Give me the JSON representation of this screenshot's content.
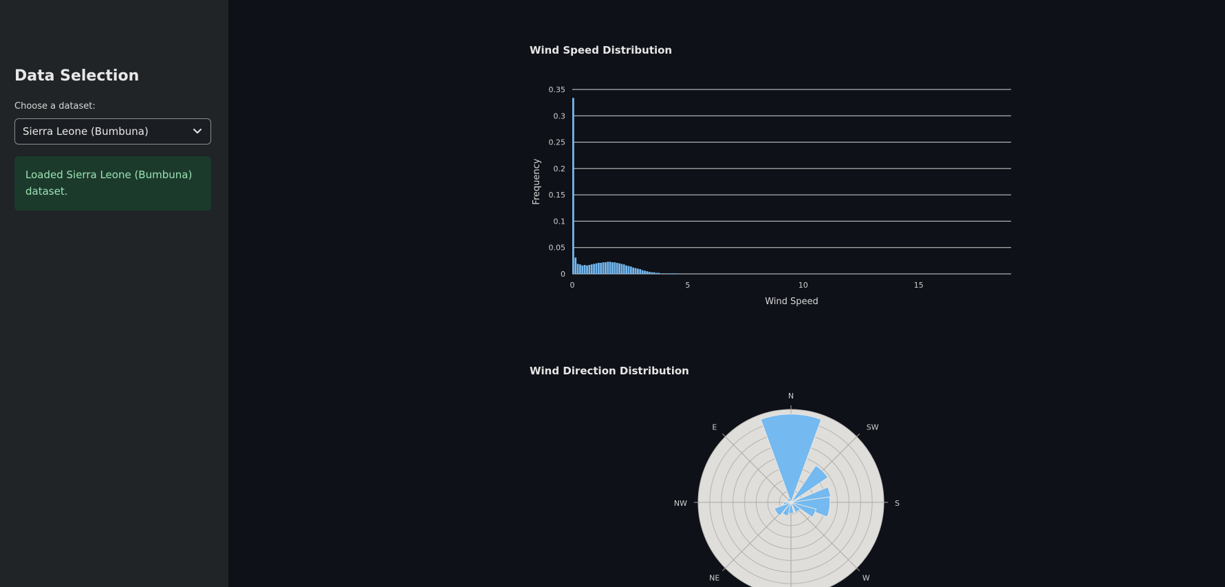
{
  "sidebar": {
    "title": "Data Selection",
    "select_label": "Choose a dataset:",
    "select_value": "Sierra Leone (Bumbuna)",
    "alert_text": "Loaded Sierra Leone (Bumbuna) dataset."
  },
  "colors": {
    "bar": "#74b9f0",
    "polar_bg": "#dfdedb",
    "alert_bg": "#1c3a2c",
    "alert_text": "#9be3b4"
  },
  "chart_data": [
    {
      "type": "bar",
      "title": "Wind Speed Distribution",
      "xlabel": "Wind Speed",
      "ylabel": "Frequency",
      "xlim": [
        0,
        19
      ],
      "ylim": [
        0,
        0.35
      ],
      "x_ticks": [
        "0",
        "5",
        "10",
        "15"
      ],
      "y_ticks": [
        "0",
        "0.05",
        "0.1",
        "0.15",
        "0.2",
        "0.25",
        "0.3",
        "0.35"
      ],
      "bin_width": 0.1,
      "values": [
        0.334,
        0.031,
        0.019,
        0.018,
        0.016,
        0.017,
        0.016,
        0.017,
        0.018,
        0.019,
        0.02,
        0.021,
        0.021,
        0.022,
        0.022,
        0.023,
        0.023,
        0.022,
        0.022,
        0.021,
        0.02,
        0.019,
        0.018,
        0.016,
        0.015,
        0.014,
        0.012,
        0.011,
        0.01,
        0.009,
        0.007,
        0.006,
        0.005,
        0.004,
        0.003,
        0.003,
        0.002,
        0.002,
        0.001,
        0.001,
        0.001,
        0.001,
        0.001,
        0.001,
        0.001,
        0.001
      ]
    },
    {
      "type": "barpolar",
      "title": "Wind Direction Distribution",
      "angular_labels": [
        "N",
        "SW",
        "S",
        "W",
        "NE",
        "NW",
        "E"
      ],
      "sectors": [
        {
          "center_deg": 0,
          "width_deg": 40,
          "r": 0.95
        },
        {
          "center_deg": 45,
          "width_deg": 22,
          "r": 0.48
        },
        {
          "center_deg": 75,
          "width_deg": 15,
          "r": 0.43
        },
        {
          "center_deg": 97,
          "width_deg": 30,
          "r": 0.42
        },
        {
          "center_deg": 115,
          "width_deg": 20,
          "r": 0.28
        },
        {
          "center_deg": 140,
          "width_deg": 30,
          "r": 0.12
        },
        {
          "center_deg": 180,
          "width_deg": 30,
          "r": 0.12
        },
        {
          "center_deg": 205,
          "width_deg": 25,
          "r": 0.15
        },
        {
          "center_deg": 235,
          "width_deg": 30,
          "r": 0.19
        },
        {
          "center_deg": 262,
          "width_deg": 20,
          "r": 0.08
        },
        {
          "center_deg": 320,
          "width_deg": 40,
          "r": 0.05
        }
      ]
    }
  ]
}
